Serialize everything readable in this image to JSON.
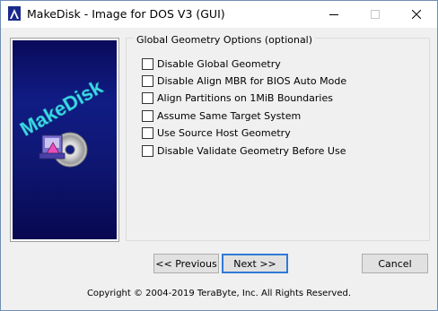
{
  "window": {
    "title": "MakeDisk - Image for DOS V3 (GUI)",
    "icon": "app-icon",
    "controls": [
      "minimize-icon",
      "maximize-icon",
      "close-icon"
    ]
  },
  "banner": {
    "logo_text": "MakeDisk",
    "logo_color": "#3fd9e8",
    "background_color": "#101c84"
  },
  "options": {
    "group_title": "Global Geometry Options (optional)",
    "items": [
      {
        "label": "Disable Global Geometry",
        "checked": false
      },
      {
        "label": "Disable Align MBR for BIOS Auto Mode",
        "checked": false
      },
      {
        "label": "Align Partitions on 1MiB Boundaries",
        "checked": false
      },
      {
        "label": "Assume Same Target System",
        "checked": false
      },
      {
        "label": "Use Source Host Geometry",
        "checked": false
      },
      {
        "label": "Disable Validate Geometry Before Use",
        "checked": false
      }
    ]
  },
  "buttons": {
    "previous": "<< Previous",
    "next": "Next >>",
    "cancel": "Cancel",
    "default_accent": "#2f7ad6"
  },
  "footer": {
    "copyright": "Copyright © 2004-2019 TeraByte, Inc.  All Rights Reserved."
  }
}
